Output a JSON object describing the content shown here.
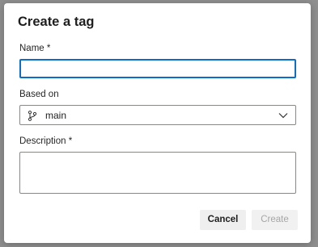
{
  "dialog": {
    "title": "Create a tag",
    "name_label": "Name *",
    "name_value": "",
    "based_on_label": "Based on",
    "based_on_value": "main",
    "description_label": "Description *",
    "description_value": "",
    "cancel_label": "Cancel",
    "create_label": "Create"
  },
  "icons": {
    "branch": "branch-icon",
    "chevron": "chevron-down-icon"
  },
  "colors": {
    "focus_border": "#0a6fc9",
    "disabled_text": "#a6a6a6"
  }
}
